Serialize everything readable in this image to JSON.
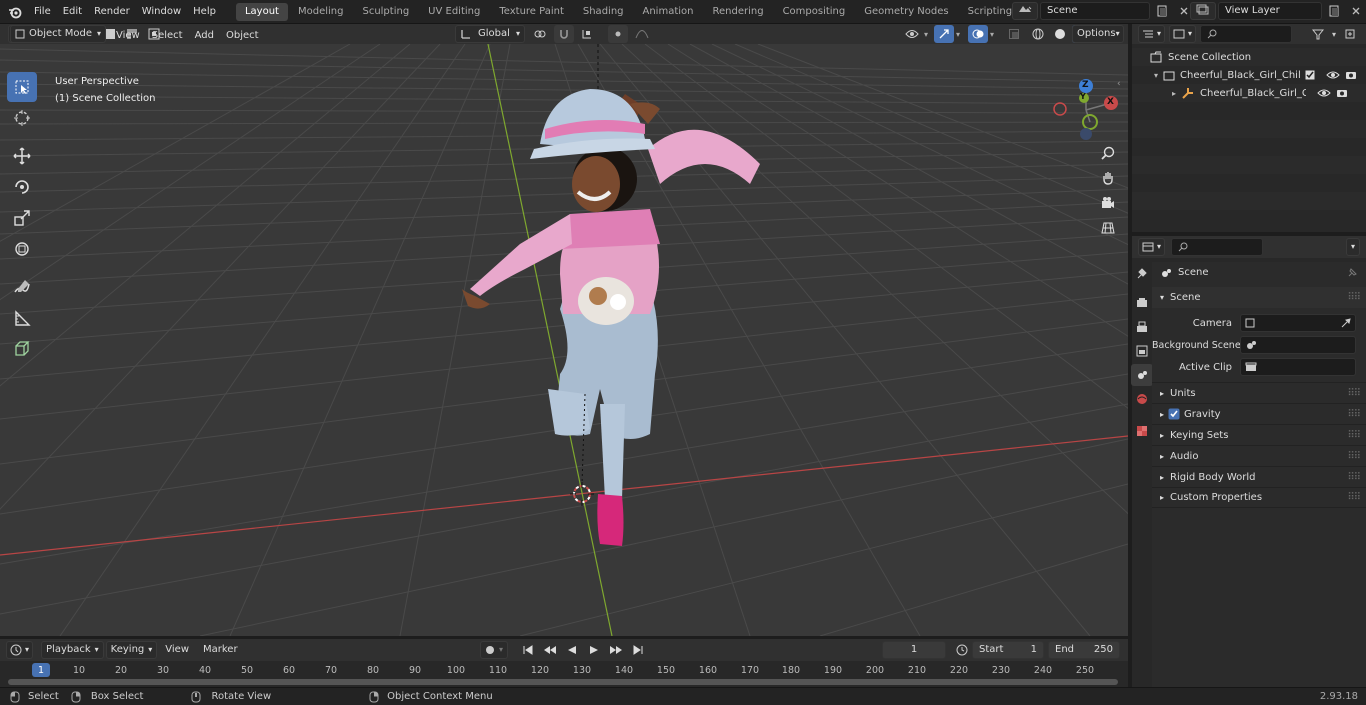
{
  "topbar": {
    "menus": [
      "File",
      "Edit",
      "Render",
      "Window",
      "Help"
    ],
    "workspaces": [
      "Layout",
      "Modeling",
      "Sculpting",
      "UV Editing",
      "Texture Paint",
      "Shading",
      "Animation",
      "Rendering",
      "Compositing",
      "Geometry Nodes",
      "Scripting"
    ],
    "active_workspace": "Layout",
    "add_tab": "+",
    "scene_name": "Scene",
    "view_layer": "View Layer"
  },
  "viewport_header": {
    "mode": "Object Mode",
    "menus": [
      "View",
      "Select",
      "Add",
      "Object"
    ],
    "transform_orientation": "Global",
    "options": "Options"
  },
  "viewport": {
    "perspective_label": "User Perspective",
    "collection_label": "(1) Scene Collection",
    "gizmo": {
      "z": "Z",
      "y": "Y",
      "x": "X"
    }
  },
  "outliner": {
    "items": [
      {
        "label": "Scene Collection"
      },
      {
        "label": "Cheerful_Black_Girl_Child_Stn"
      },
      {
        "label": "Cheerful_Black_Girl_Chilc"
      }
    ]
  },
  "properties": {
    "header": "Scene",
    "panel_title": "Scene",
    "fields": [
      {
        "label": "Camera"
      },
      {
        "label": "Background Scene"
      },
      {
        "label": "Active Clip"
      }
    ],
    "sections": [
      "Units",
      "Gravity",
      "Keying Sets",
      "Audio",
      "Rigid Body World",
      "Custom Properties"
    ],
    "gravity_checked": true
  },
  "timeline": {
    "menus": [
      "Playback",
      "Keying",
      "View",
      "Marker"
    ],
    "current_frame": "1",
    "start_label": "Start",
    "start_value": "1",
    "end_label": "End",
    "end_value": "250",
    "ticks": [
      "1",
      "10",
      "20",
      "30",
      "40",
      "50",
      "60",
      "70",
      "80",
      "90",
      "100",
      "110",
      "120",
      "130",
      "140",
      "150",
      "160",
      "170",
      "180",
      "190",
      "200",
      "210",
      "220",
      "230",
      "240",
      "250"
    ]
  },
  "statusbar": {
    "select": "Select",
    "box_select": "Box Select",
    "rotate_view": "Rotate View",
    "context_menu": "Object Context Menu",
    "version": "2.93.18"
  },
  "colors": {
    "accent": "#4772b3",
    "x_axis": "#c84a4a",
    "y_axis": "#7fa82f",
    "z_axis": "#3d7fd6"
  }
}
